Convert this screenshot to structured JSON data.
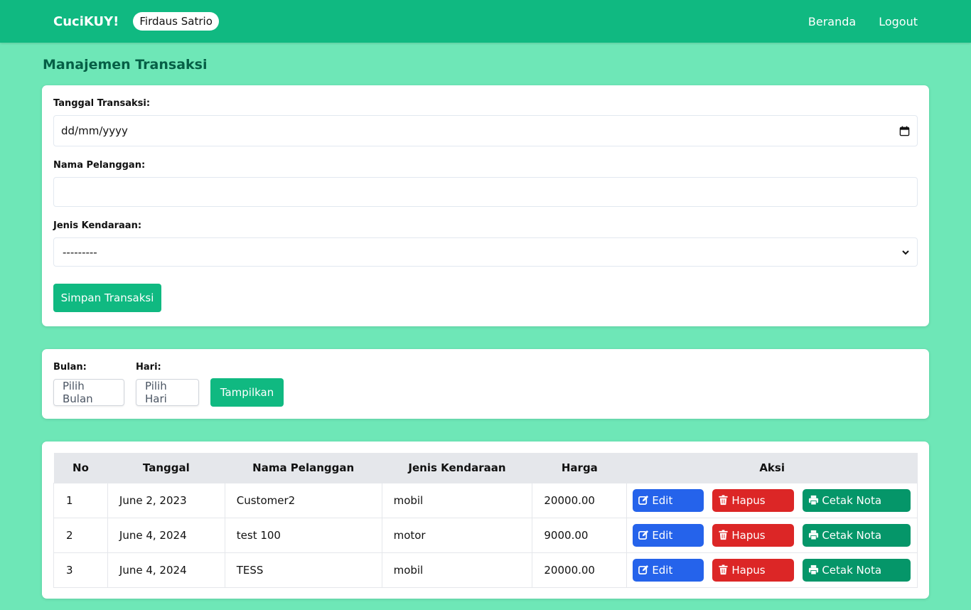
{
  "navbar": {
    "brand": "CuciKUY!",
    "user": "Firdaus Satrio",
    "links": [
      "Beranda",
      "Logout"
    ]
  },
  "page": {
    "title": "Manajemen Transaksi"
  },
  "form": {
    "date_label": "Tanggal Transaksi:",
    "date_placeholder": "dd/mm/yyyy",
    "name_label": "Nama Pelanggan:",
    "name_value": "",
    "vehicle_label": "Jenis Kendaraan:",
    "vehicle_selected": "---------",
    "submit_label": "Simpan Transaksi"
  },
  "filter": {
    "month_label": "Bulan:",
    "month_placeholder": "Pilih Bulan",
    "day_label": "Hari:",
    "day_placeholder": "Pilih Hari",
    "submit_label": "Tampilkan"
  },
  "table": {
    "headers": [
      "No",
      "Tanggal",
      "Nama Pelanggan",
      "Jenis Kendaraan",
      "Harga",
      "Aksi"
    ],
    "rows": [
      [
        "1",
        "June 2, 2023",
        "Customer2",
        "mobil",
        "20000.00"
      ],
      [
        "2",
        "June 4, 2024",
        "test 100",
        "motor",
        "9000.00"
      ],
      [
        "3",
        "June 4, 2024",
        "TESS",
        "mobil",
        "20000.00"
      ]
    ],
    "actions": {
      "edit": "Edit",
      "delete": "Hapus",
      "print": "Cetak Nota"
    }
  },
  "colors": {
    "navbar": "#10b981",
    "background": "#6ee7b7",
    "edit": "#2563eb",
    "delete": "#dc2626",
    "print": "#059669"
  }
}
